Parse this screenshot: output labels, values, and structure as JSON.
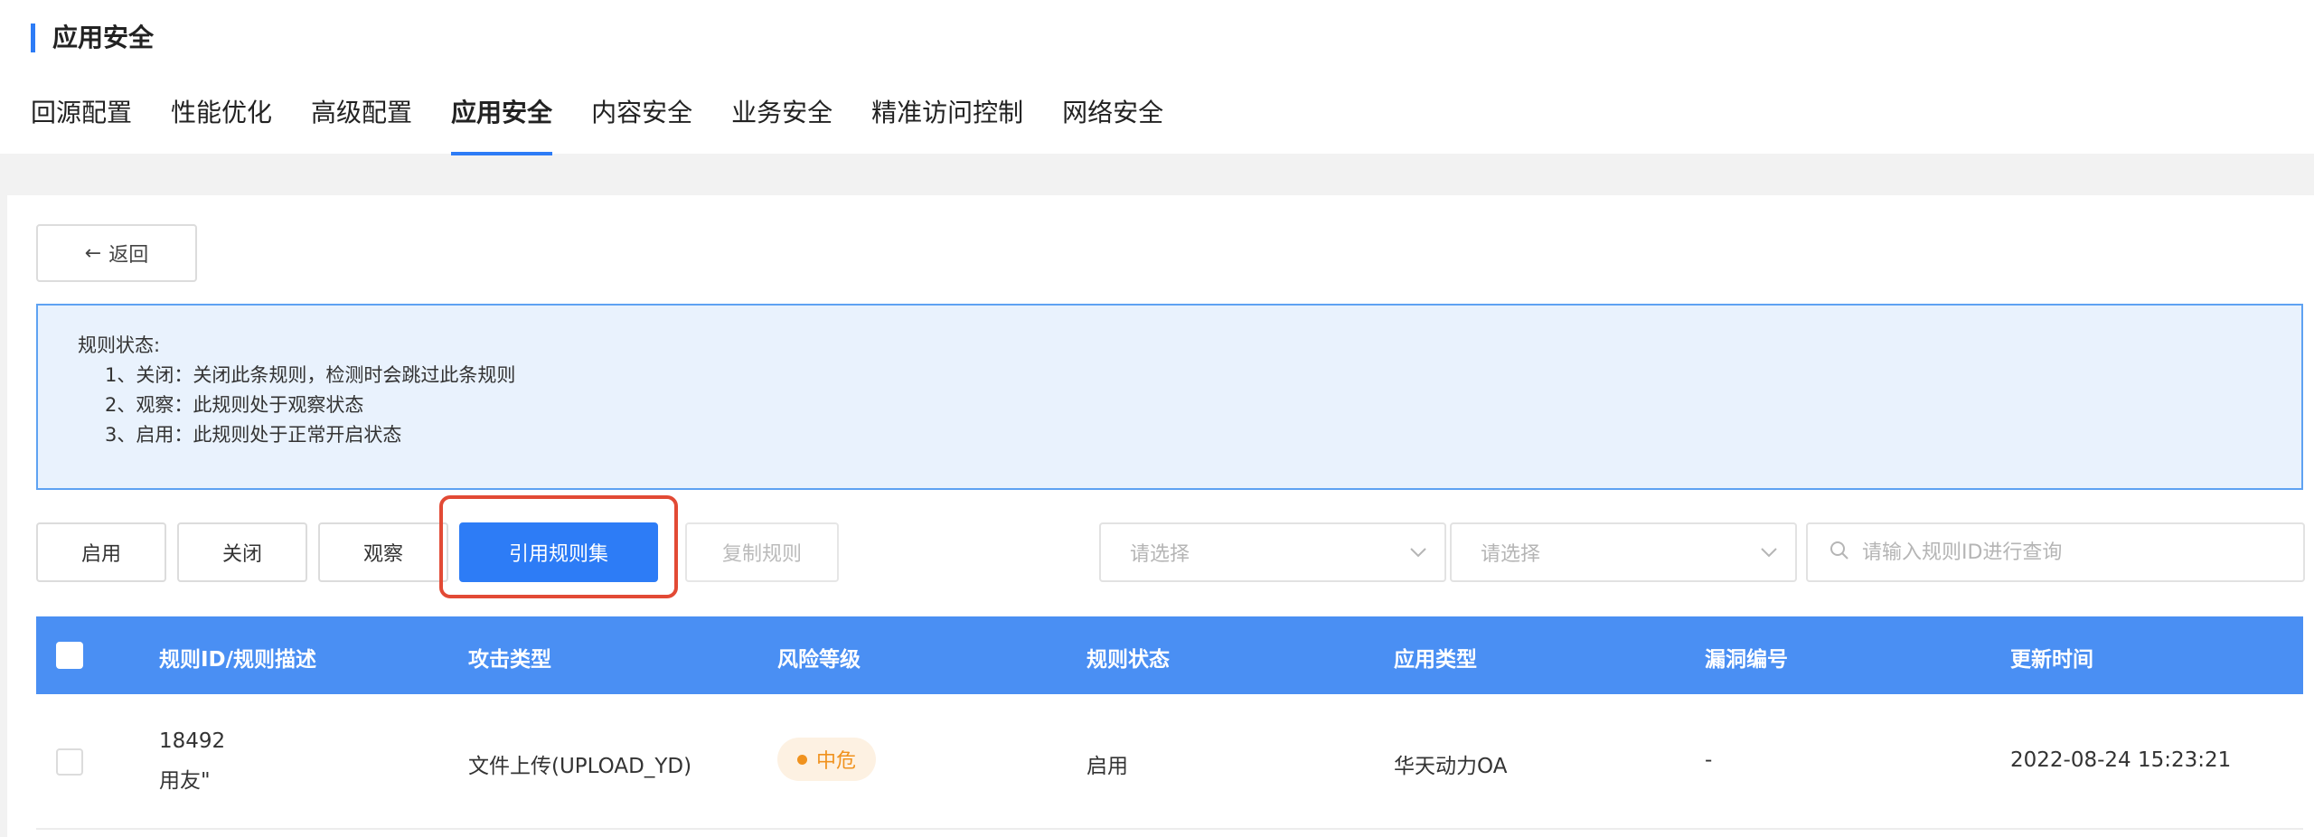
{
  "header": {
    "section_title": "应用安全",
    "tabs": [
      {
        "label": "回源配置"
      },
      {
        "label": "性能优化"
      },
      {
        "label": "高级配置"
      },
      {
        "label": "应用安全",
        "active": true
      },
      {
        "label": "内容安全"
      },
      {
        "label": "业务安全"
      },
      {
        "label": "精准访问控制"
      },
      {
        "label": "网络安全"
      }
    ]
  },
  "back_button": {
    "arrow": "←",
    "label": "返回"
  },
  "notice": {
    "title": "规则状态:",
    "items": [
      "1、关闭：关闭此条规则，检测时会跳过此条规则",
      "2、观察：此规则处于观察状态",
      "3、启用：此规则处于正常开启状态"
    ]
  },
  "toolbar": {
    "enable_label": "启用",
    "close_label": "关闭",
    "observe_label": "观察",
    "reference_ruleset_label": "引用规则集",
    "copy_rule_label": "复制规则",
    "select1_placeholder": "请选择",
    "select2_placeholder": "请选择",
    "search_placeholder": "请输入规则ID进行查询"
  },
  "table": {
    "columns": [
      "规则ID/规则描述",
      "攻击类型",
      "风险等级",
      "规则状态",
      "应用类型",
      "漏洞编号",
      "更新时间"
    ],
    "rows": [
      {
        "rule_id": "18492",
        "description": "用友\"",
        "attack_type": "文件上传(UPLOAD_YD)",
        "risk_level": "中危",
        "status": "启用",
        "app_type": "华天动力OA",
        "vuln_id": "-",
        "updated": "2022-08-24 15:23:21"
      }
    ]
  },
  "colors": {
    "accent": "#2d7cf6",
    "table_header": "#4a8ff3",
    "notice_bg": "#e9f2fd",
    "highlight": "#e24a35",
    "risk_medium": "#f0921e"
  }
}
